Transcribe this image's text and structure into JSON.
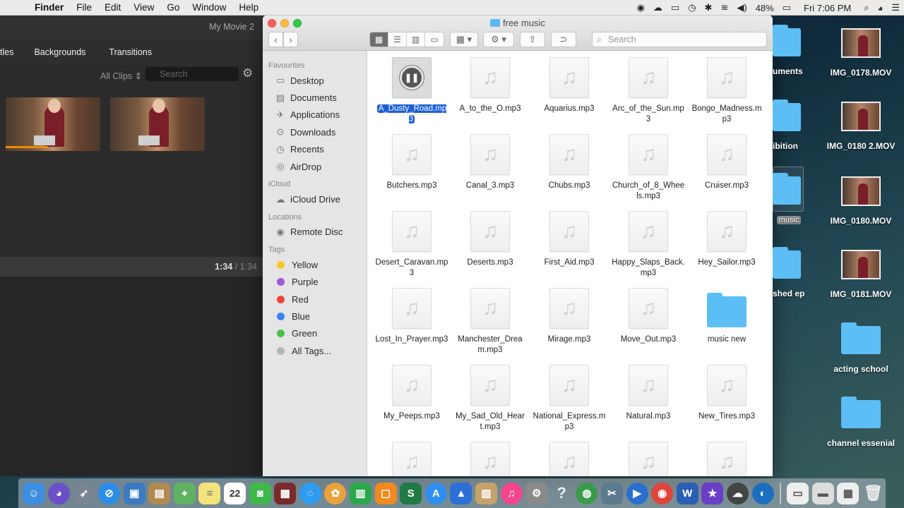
{
  "menubar": {
    "app": "Finder",
    "items": [
      "File",
      "Edit",
      "View",
      "Go",
      "Window",
      "Help"
    ],
    "battery": "48%",
    "clock": "Fri 7:06 PM"
  },
  "imovie": {
    "movie_title": "My Movie 2",
    "tabs": [
      "tles",
      "Backgrounds",
      "Transitions"
    ],
    "all_clips": "All Clips",
    "search_placeholder": "Search",
    "time_current": "1:34",
    "time_sep": "/",
    "time_total": "1:34"
  },
  "finder": {
    "title": "free music",
    "search_placeholder": "Search",
    "sidebar": {
      "favourites_header": "Favourites",
      "favourites": [
        "Desktop",
        "Documents",
        "Applications",
        "Downloads",
        "Recents",
        "AirDrop"
      ],
      "icloud_header": "iCloud",
      "icloud": [
        "iCloud Drive"
      ],
      "locations_header": "Locations",
      "locations": [
        "Remote Disc"
      ],
      "tags_header": "Tags",
      "tags": [
        {
          "label": "Yellow",
          "color": "#f7c824"
        },
        {
          "label": "Purple",
          "color": "#a259d9"
        },
        {
          "label": "Red",
          "color": "#f0453a"
        },
        {
          "label": "Blue",
          "color": "#3b82f6"
        },
        {
          "label": "Green",
          "color": "#4cc24a"
        },
        {
          "label": "All Tags...",
          "color": "#b5b5b5"
        }
      ]
    },
    "files": [
      "A_Dusty_Road.mp3",
      "A_to_the_O.mp3",
      "Aquarius.mp3",
      "Arc_of_the_Sun.mp3",
      "Bongo_Madness.mp3",
      "Butchers.mp3",
      "Canal_3.mp3",
      "Chubs.mp3",
      "Church_of_8_Wheels.mp3",
      "Cruiser.mp3",
      "Desert_Caravan.mp3",
      "Deserts.mp3",
      "First_Aid.mp3",
      "Happy_Slaps_Back.mp3",
      "Hey_Sailor.mp3",
      "Lost_In_Prayer.mp3",
      "Manchester_Dream.mp3",
      "Mirage.mp3",
      "Move_Out.mp3",
      "music new",
      "My_Peeps.mp3",
      "My_Sad_Old_Heart.mp3",
      "National_Express.mp3",
      "Natural.mp3",
      "New_Tires.mp3",
      "",
      "",
      "",
      "",
      ""
    ]
  },
  "desktop": {
    "left_labels": [
      "uments",
      "ibition",
      "music",
      "shed ep"
    ],
    "right_items": [
      "IMG_0178.MOV",
      "IMG_0180 2.MOV",
      "IMG_0180.MOV",
      "IMG_0181.MOV",
      "acting school",
      "channel essenial"
    ]
  },
  "dock": {
    "calendar_day": "22"
  }
}
